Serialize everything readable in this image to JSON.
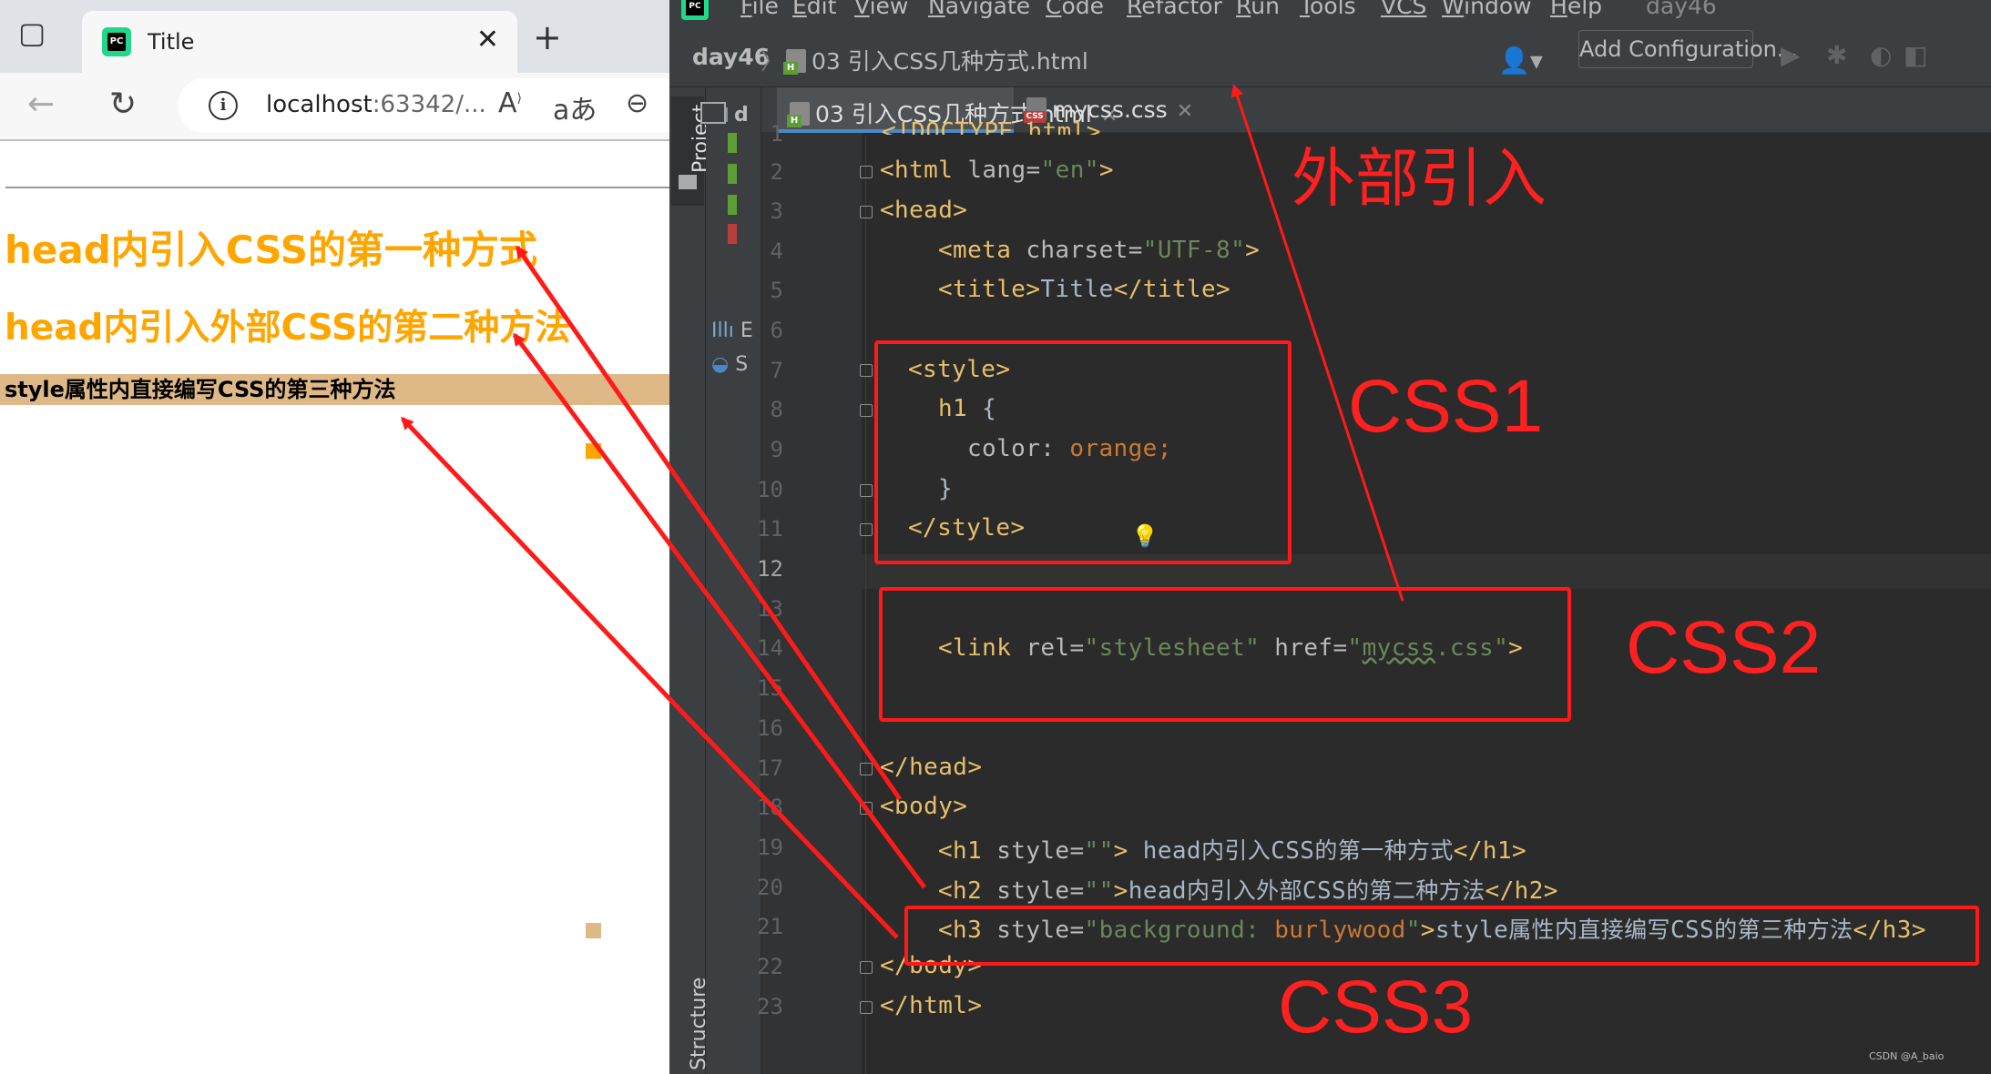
{
  "browser": {
    "tab_title": "Title",
    "url_host": "localhost",
    "url_rest": ":63342/...",
    "page": {
      "h1": "head内引入CSS的第一种方式",
      "h2": "head内引入外部CSS的第二种方法",
      "h3": "style属性内直接编写CSS的第三种方法"
    }
  },
  "ide": {
    "menu": [
      {
        "key": "F",
        "rest": "ile"
      },
      {
        "key": "E",
        "rest": "dit"
      },
      {
        "key": "V",
        "rest": "iew"
      },
      {
        "key": "N",
        "rest": "avigate"
      },
      {
        "key": "C",
        "rest": "ode"
      },
      {
        "key": "R",
        "rest": "efactor"
      },
      {
        "key": "R",
        "rest": "un"
      },
      {
        "key": "T",
        "rest": "ools"
      },
      {
        "key": "VCS",
        "rest": ""
      },
      {
        "key": "W",
        "rest": "indow"
      },
      {
        "key": "H",
        "rest": "elp"
      }
    ],
    "project_title": "day46",
    "breadcrumb_project": "day46",
    "breadcrumb_file": "03 引入CSS几种方式.html",
    "add_configuration": "Add Configuration...",
    "tabs": [
      {
        "label": "03 引入CSS几种方式.html",
        "type": "html"
      },
      {
        "label": "mycss.css",
        "type": "css"
      }
    ],
    "project_panel_label": "Project",
    "structure_label": "Structure",
    "project_items": [
      "d",
      "E",
      "S"
    ],
    "line_numbers": [
      "1",
      "2",
      "3",
      "4",
      "5",
      "6",
      "7",
      "8",
      "9",
      "10",
      "11",
      "12",
      "13",
      "14",
      "15",
      "16",
      "17",
      "18",
      "19",
      "20",
      "21",
      "22",
      "23"
    ],
    "current_line": "12",
    "colors": {
      "orange_swatch": "#ffa500",
      "burlywood_swatch": "#deb887",
      "annotation_red": "#ff1a1a"
    }
  },
  "annotations": {
    "external": "外部引入",
    "css1": "CSS1",
    "css2": "CSS2",
    "css3": "CSS3"
  },
  "watermark": "CSDN @A_baio"
}
